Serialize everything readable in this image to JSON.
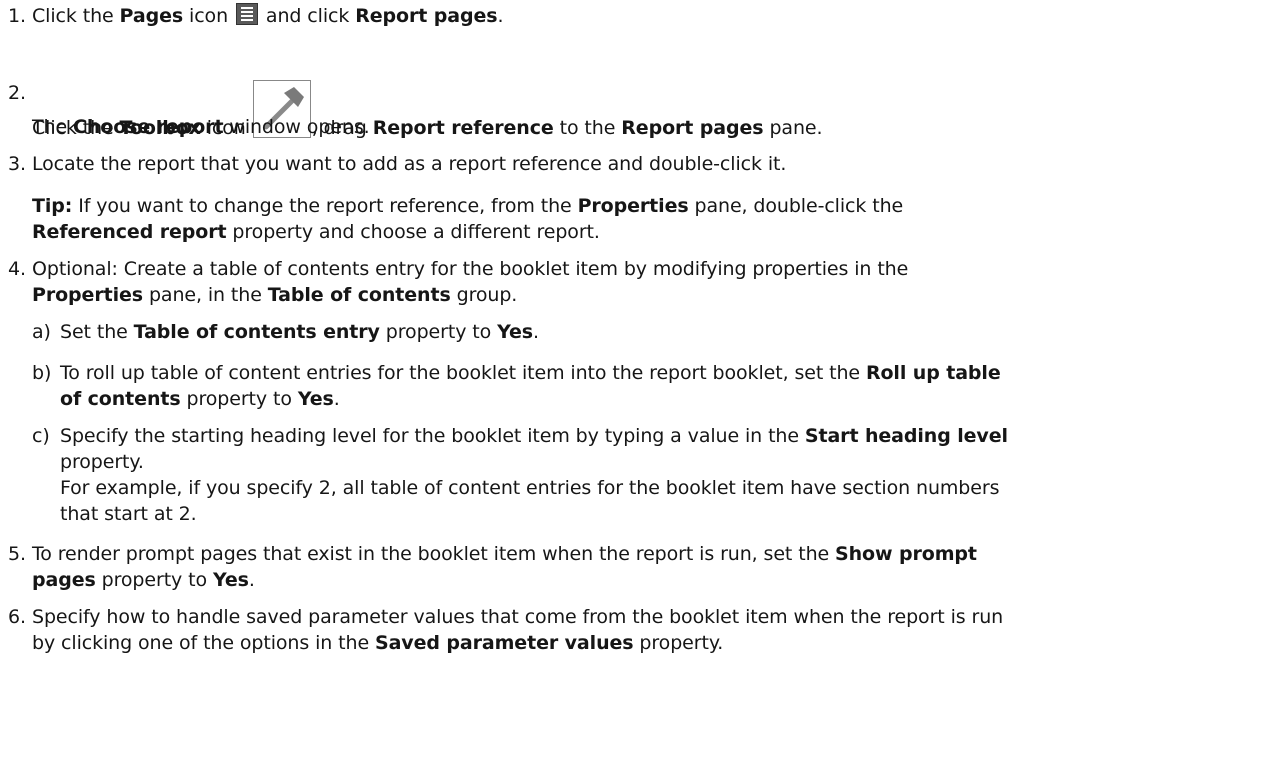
{
  "steps": [
    {
      "num": "1.",
      "t1": "Click the ",
      "b1": "Pages",
      "t2": " icon ",
      "icon": "pages-icon",
      "t3": " and click ",
      "b2": "Report pages",
      "t4": "."
    },
    {
      "num": "2.",
      "t1": "Click the ",
      "b1": "Toolbox",
      "t2": " icon ",
      "icon": "toolbox-hammer-icon",
      "t3": ", drag ",
      "b2": "Report reference",
      "t4": " to the ",
      "b3": "Report pages",
      "t5": " pane.",
      "sub_b": "Choose report",
      "sub_pre": "The ",
      "sub_post": " window opens."
    },
    {
      "num": "3.",
      "text": "Locate the report that you want to add as a report reference and double-click it.",
      "tip_b": "Tip:",
      "tip_t1": " If you want to change the report reference, from the ",
      "tip_b2": "Properties",
      "tip_t2": " pane, double-click the",
      "tip_b3": "Referenced report",
      "tip_t3": " property and choose a different report."
    },
    {
      "num": "4.",
      "t1": "Optional: Create a table of contents entry for the booklet item by modifying properties in the",
      "b1": "Properties",
      "t2": " pane, in the ",
      "b2": "Table of contents",
      "t3": " group."
    },
    {
      "num": "5.",
      "t1": "To render prompt pages that exist in the booklet item when the report is run, set the ",
      "b1": "Show prompt",
      "b2": "pages",
      "t2": " property to ",
      "b3": "Yes",
      "t3": "."
    },
    {
      "num": "6.",
      "t1": "Specify how to handle saved parameter values that come from the booklet item when the report is run",
      "t2": "by clicking one of the options in the ",
      "b1": "Saved parameter values",
      "t3": " property."
    }
  ],
  "substeps": [
    {
      "num": "a)",
      "t1": "Set the ",
      "b1": "Table of contents entry",
      "t2": " property to ",
      "b2": "Yes",
      "t3": "."
    },
    {
      "num": "b)",
      "t1": "To roll up table of content entries for the booklet item into the report booklet, set the ",
      "b1": "Roll up table",
      "b2": "of contents",
      "t2": " property to ",
      "b3": "Yes",
      "t3": "."
    },
    {
      "num": "c)",
      "t1": "Specify the starting heading level for the booklet item by typing a value in the ",
      "b1": "Start heading level",
      "t2": "property.",
      "ex1": "For example, if you specify 2, all table of content entries for the booklet item have section numbers",
      "ex2": "that start at 2."
    }
  ]
}
